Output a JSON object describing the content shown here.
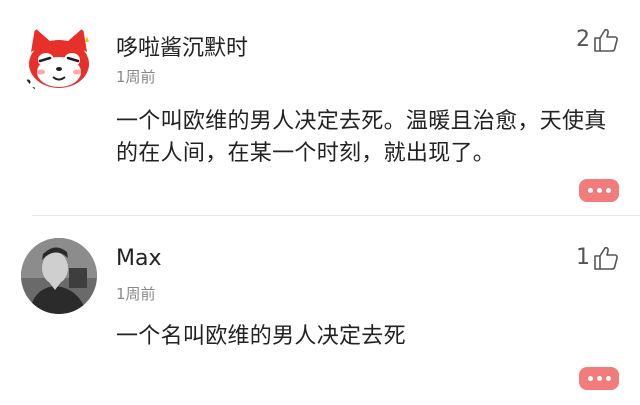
{
  "comments": [
    {
      "username": "哆啦酱沉默时",
      "time": "1周前",
      "likes": "2",
      "text": "一个叫欧维的男人决定去死。温暖且治愈，天使真的在人间，在某一个时刻，就出现了。",
      "avatar": "red-cartoon-fox-avatar"
    },
    {
      "username": "Max",
      "time": "1周前",
      "likes": "1",
      "text": "一个名叫欧维的男人决定去死",
      "avatar": "grayscale-portrait-avatar"
    }
  ],
  "colors": {
    "reply_button": "#f27b7b",
    "divider": "#e6e6e6",
    "muted_text": "#8a8a8a"
  }
}
